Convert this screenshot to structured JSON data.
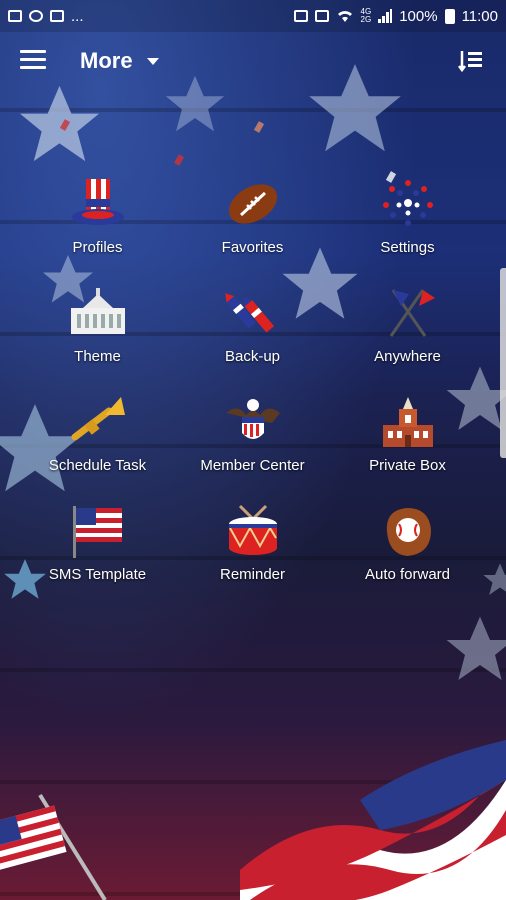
{
  "status_bar": {
    "left_more": "...",
    "network": "4G",
    "network2": "2G",
    "battery_text": "100%",
    "time": "11:00"
  },
  "toolbar": {
    "title": "More"
  },
  "grid": [
    {
      "label": "Profiles",
      "icon": "uncle-sam-hat-icon"
    },
    {
      "label": "Favorites",
      "icon": "football-icon"
    },
    {
      "label": "Settings",
      "icon": "fireworks-icon"
    },
    {
      "label": "Theme",
      "icon": "white-house-icon"
    },
    {
      "label": "Back-up",
      "icon": "rockets-icon"
    },
    {
      "label": "Anywhere",
      "icon": "crossed-flags-icon"
    },
    {
      "label": "Schedule Task",
      "icon": "trumpet-icon"
    },
    {
      "label": "Member Center",
      "icon": "eagle-seal-icon"
    },
    {
      "label": "Private Box",
      "icon": "independence-hall-icon"
    },
    {
      "label": "SMS Template",
      "icon": "us-flag-icon"
    },
    {
      "label": "Reminder",
      "icon": "drum-icon"
    },
    {
      "label": "Auto forward",
      "icon": "baseball-glove-icon"
    }
  ],
  "colors": {
    "accent_red": "#c8202f",
    "accent_blue": "#1c2f77",
    "text": "#ffffff"
  }
}
